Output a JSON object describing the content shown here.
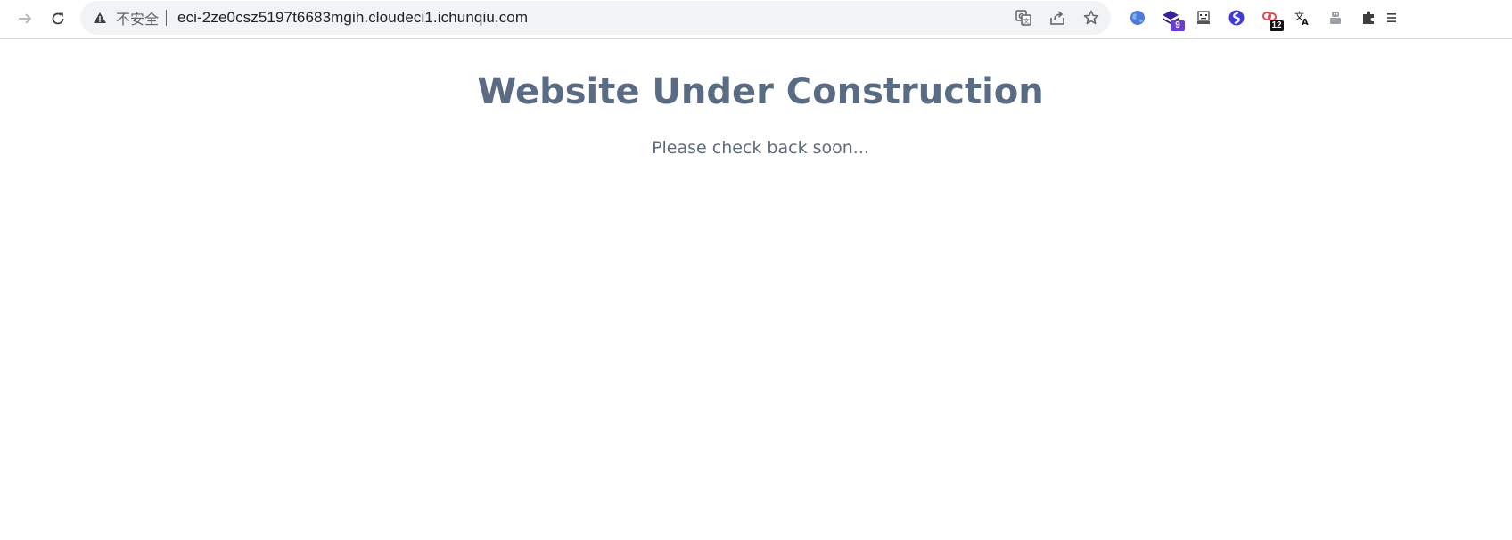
{
  "browser": {
    "security_label": "不安全",
    "url": "eci-2ze0csz5197t6683mgih.cloudeci1.ichunqiu.com",
    "extensions": [
      {
        "name": "globe-extension",
        "badge": ""
      },
      {
        "name": "layers-extension",
        "badge": "9",
        "badge_color": "#6a3dd6"
      },
      {
        "name": "pixel-face-extension",
        "badge": ""
      },
      {
        "name": "swirl-extension",
        "badge": ""
      },
      {
        "name": "link-extension",
        "badge": "12",
        "badge_color": "#111111"
      },
      {
        "name": "translate-extension",
        "badge": ""
      },
      {
        "name": "robot-extension",
        "badge": ""
      },
      {
        "name": "puzzle-extensions",
        "badge": ""
      }
    ]
  },
  "page": {
    "headline": "Website Under Construction",
    "subline": "Please check back soon..."
  },
  "colors": {
    "headline": "#5a6b84",
    "subline": "#5f6b7e",
    "toolbar_icons": "#5f6368",
    "omnibox_bg": "#f1f3f4"
  }
}
